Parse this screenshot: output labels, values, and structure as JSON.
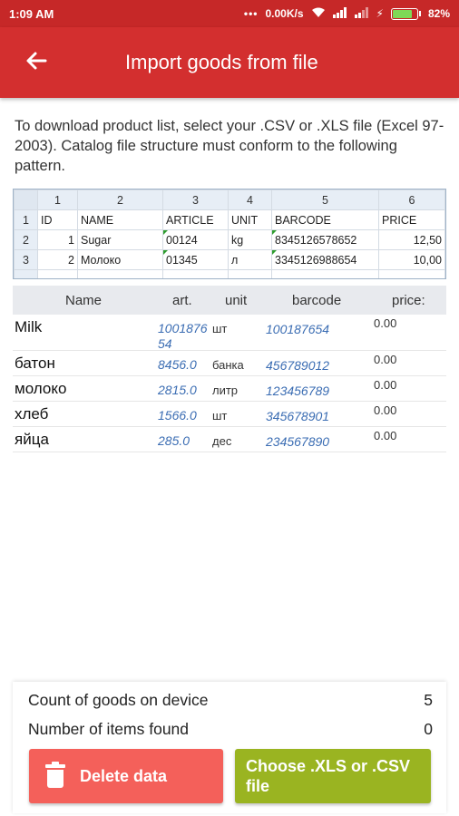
{
  "status": {
    "time": "1:09 AM",
    "network": "0.00K/s",
    "battery_text": "82%",
    "battery_level": 0.82
  },
  "appbar": {
    "title": "Import goods from file"
  },
  "intro": "To download product list, select your .CSV or .XLS file (Excel 97-2003). Catalog file structure must conform to the following pattern.",
  "sheet": {
    "col_numbers": [
      "1",
      "2",
      "3",
      "4",
      "5",
      "6"
    ],
    "rows": [
      {
        "num": "1",
        "cells": [
          "ID",
          "NAME",
          "ARTICLE",
          "UNIT",
          "BARCODE",
          "PRICE"
        ]
      },
      {
        "num": "2",
        "cells": [
          "1",
          "Sugar",
          "00124",
          "kg",
          "8345126578652",
          "12,50"
        ]
      },
      {
        "num": "3",
        "cells": [
          "2",
          "Молоко",
          "01345",
          "л",
          "3345126988654",
          "10,00"
        ]
      }
    ]
  },
  "goods_table": {
    "headers": {
      "name": "Name",
      "art": "art.",
      "unit": "unit",
      "barcode": "barcode",
      "price": "price:"
    },
    "rows": [
      {
        "name": "Milk",
        "art": "100187654",
        "unit": "шт",
        "barcode": "100187654",
        "price": "0.00"
      },
      {
        "name": "батон",
        "art": "8456.0",
        "unit": "банка",
        "barcode": "456789012",
        "price": "0.00"
      },
      {
        "name": "молоко",
        "art": "2815.0",
        "unit": "литр",
        "barcode": "123456789",
        "price": "0.00"
      },
      {
        "name": "хлеб",
        "art": "1566.0",
        "unit": "шт",
        "barcode": "345678901",
        "price": "0.00"
      },
      {
        "name": "яйца",
        "art": "285.0",
        "unit": "дес",
        "barcode": "234567890",
        "price": "0.00"
      }
    ]
  },
  "footer": {
    "count_label": "Count of goods on device",
    "count_value": "5",
    "found_label": "Number of items found",
    "found_value": "0",
    "delete_label": "Delete data",
    "choose_label": "Choose .XLS or .CSV file"
  },
  "colors": {
    "primary": "#d32f2f",
    "statusbar": "#c62828",
    "delete": "#f4605a",
    "choose": "#9ab421",
    "link_blue": "#3b6db3"
  },
  "icons": {
    "back": "arrow-left-icon",
    "delete": "trash-icon"
  }
}
